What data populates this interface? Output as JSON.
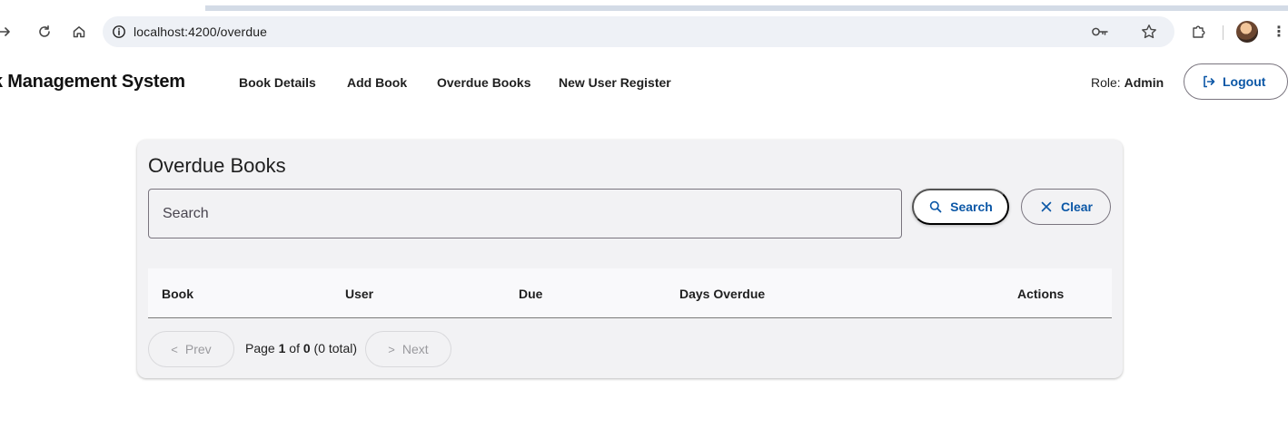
{
  "browser": {
    "url": "localhost:4200/overdue",
    "icons": {
      "forward": "forward-arrow-icon",
      "reload": "reload-icon",
      "home": "home-icon",
      "site_info": "info-icon",
      "password": "key-icon",
      "bookmark": "star-icon",
      "extensions": "puzzle-icon",
      "menu": "more-vert-icon"
    }
  },
  "header": {
    "brand": "ok Management System",
    "nav": [
      {
        "label": "Book Details"
      },
      {
        "label": "Add Book"
      },
      {
        "label": "Overdue Books"
      },
      {
        "label": "New User Register"
      }
    ],
    "role_label": "Role:",
    "role_value": "Admin",
    "logout_label": "Logout"
  },
  "card": {
    "title": "Overdue Books",
    "search_placeholder": "Search",
    "search_button": "Search",
    "clear_button": "Clear",
    "columns": [
      "Book",
      "User",
      "Due",
      "Days Overdue",
      "Actions"
    ],
    "rows": [],
    "pagination": {
      "prev_label": "Prev",
      "next_label": "Next",
      "page_prefix": "Page",
      "current_page": "1",
      "of_label": "of",
      "total_pages": "0",
      "total_text": "(0 total)"
    }
  },
  "colors": {
    "accent": "#0b57a6",
    "card_bg": "#f2f2f4",
    "outline": "#79747e",
    "disabled_text": "#9a9a9e"
  }
}
